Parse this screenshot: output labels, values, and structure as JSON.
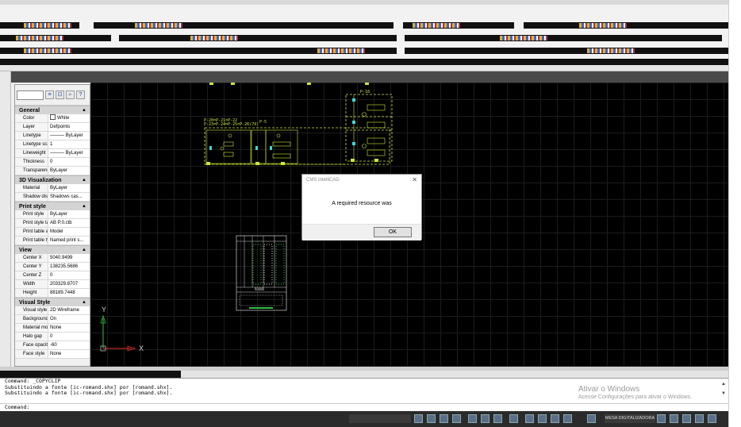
{
  "properties": {
    "sections": [
      {
        "title": "General",
        "rows": [
          {
            "key": "Color",
            "value": "White",
            "swatch": true
          },
          {
            "key": "Layer",
            "value": "Defpoints"
          },
          {
            "key": "Linetype",
            "value": "——— ByLayer"
          },
          {
            "key": "Linetype scale",
            "value": "1"
          },
          {
            "key": "Lineweight",
            "value": "——— ByLayer"
          },
          {
            "key": "Thickness",
            "value": "0"
          },
          {
            "key": "Transparency",
            "value": "ByLayer"
          }
        ]
      },
      {
        "title": "3D Visualization",
        "rows": [
          {
            "key": "Material",
            "value": "ByLayer"
          },
          {
            "key": "Shadow displ...",
            "value": "Shadows cas..."
          }
        ]
      },
      {
        "title": "Print style",
        "rows": [
          {
            "key": "Print style",
            "value": "ByLayer"
          },
          {
            "key": "Print style table",
            "value": "AB P.0.ctb"
          },
          {
            "key": "Print table att...",
            "value": "Model"
          },
          {
            "key": "Print table type",
            "value": "Named print s..."
          }
        ]
      },
      {
        "title": "View",
        "rows": [
          {
            "key": "Center X",
            "value": "5040.9499"
          },
          {
            "key": "Center Y",
            "value": "138235.5686"
          },
          {
            "key": "Center Z",
            "value": "0"
          },
          {
            "key": "Width",
            "value": "203329.8707"
          },
          {
            "key": "Height",
            "value": "88189.7448"
          }
        ]
      },
      {
        "title": "Visual Style",
        "rows": [
          {
            "key": "Visual style",
            "value": "2D Wireframe"
          },
          {
            "key": "Background",
            "value": "On"
          },
          {
            "key": "Material mode",
            "value": "None"
          },
          {
            "key": "Halo gap",
            "value": "0"
          },
          {
            "key": "Face opacity",
            "value": "-60"
          },
          {
            "key": "Face style",
            "value": "None"
          }
        ]
      }
    ]
  },
  "drawing": {
    "label_p18": "P-18",
    "label_p5": "P-5",
    "label_p20": "P-20=P-21=P-22",
    "label_p23": "P-23=P-24=P-25=P-26(7X)",
    "table_heading": "ROUND",
    "ucs_y": "Y",
    "ucs_x": "X"
  },
  "dialog": {
    "title": "CMS IntelliCAD",
    "message": "A required resource was",
    "ok_label": "OK",
    "close_symbol": "✕"
  },
  "command": {
    "lines": [
      "Command: _COPYCLIP",
      "Substituindo a fonte [ic-romand.shx] por [romand.shx].",
      "Substituindo a fonte [ic-romand.shx] por [romand.shx]."
    ],
    "prompt": "Command:"
  },
  "watermark": {
    "title": "Ativar o Windows",
    "subtitle": "Acesse Configurações para ativar o Windows."
  },
  "statusbar": {
    "model_label": "MESA DIGITALIZADORA"
  },
  "colors": {
    "canvas_bg": "#000000",
    "cad_yellow": "#c8e83a",
    "cad_cyan": "#3fd8d8",
    "ucs_red": "#e23030",
    "ucs_green": "#30c040"
  }
}
